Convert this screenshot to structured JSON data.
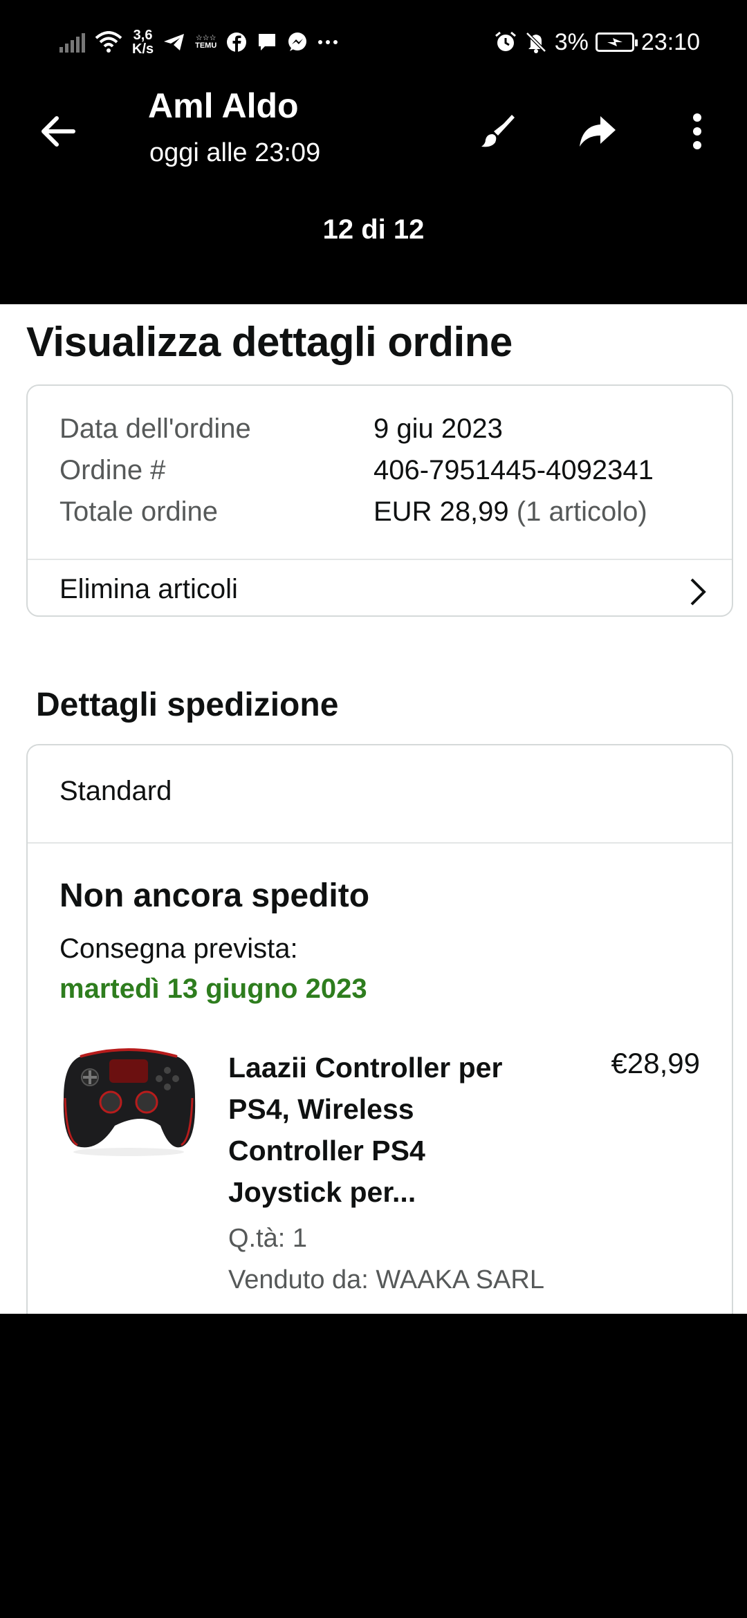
{
  "status_bar": {
    "net_speed_value": "3,6",
    "net_speed_unit": "K/s",
    "temu_label_top": "☆☆☆",
    "temu_label": "TEMU",
    "battery": "3%",
    "time": "23:10",
    "icons": [
      "signal-icon",
      "wifi-icon",
      "telegram-icon",
      "temu-icon",
      "facebook-icon",
      "chat-icon",
      "messenger-icon",
      "more-notifications-icon",
      "alarm-icon",
      "mute-icon",
      "battery-icon"
    ]
  },
  "viewer": {
    "sender": "Aml Aldo",
    "timestamp": "oggi alle 23:09",
    "counter": "12 di 12",
    "actions": [
      "edit-icon",
      "share-icon",
      "more-icon"
    ]
  },
  "order": {
    "title": "Visualizza dettagli ordine",
    "date_label": "Data dell'ordine",
    "date_value": "9 giu 2023",
    "number_label": "Ordine #",
    "number_value": "406-7951445-4092341",
    "total_label": "Totale ordine",
    "total_value": "EUR 28,99",
    "total_items": "(1 articolo)",
    "delete_items": "Elimina articoli"
  },
  "shipping": {
    "title": "Dettagli spedizione",
    "method": "Standard",
    "status": "Non ancora spedito",
    "delivery_label": "Consegna prevista:",
    "delivery_date": "martedì 13 giugno 2023",
    "accent_color": "#2e7d1e"
  },
  "product": {
    "title": "Laazii Controller per PS4, Wireless Controller PS4 Joystick per...",
    "price": "€28,99",
    "quantity": "Q.tà: 1",
    "seller": "Venduto da: WAAKA SARL"
  }
}
